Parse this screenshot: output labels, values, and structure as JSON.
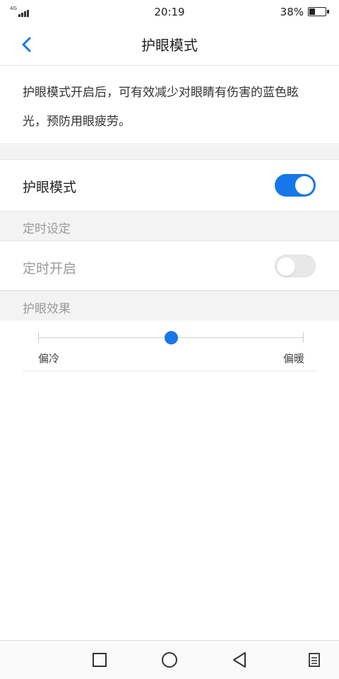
{
  "status_bar": {
    "network": "4G",
    "time": "20:19",
    "battery_percent": "38%",
    "battery_level": 0.38
  },
  "header": {
    "title": "护眼模式",
    "back_icon": "chevron-left-icon"
  },
  "description": "护眼模式开启后，可有效减少对眼睛有伤害的蓝色眩光，预防用眼疲劳。",
  "eye_mode": {
    "label": "护眼模式",
    "enabled": true
  },
  "timer_section": {
    "header": "定时设定",
    "timer": {
      "label": "定时开启",
      "enabled": false
    }
  },
  "effect_section": {
    "header": "护眼效果",
    "slider": {
      "min_label": "偏冷",
      "max_label": "偏暖",
      "value": 0.5
    }
  },
  "nav_bar": {
    "icons": [
      "square-icon",
      "home-circle-icon",
      "back-triangle-icon",
      "menu-icon"
    ]
  },
  "colors": {
    "accent": "#1677e8",
    "section_bg": "#f3f3f3",
    "muted_text": "#9a9a9a"
  }
}
